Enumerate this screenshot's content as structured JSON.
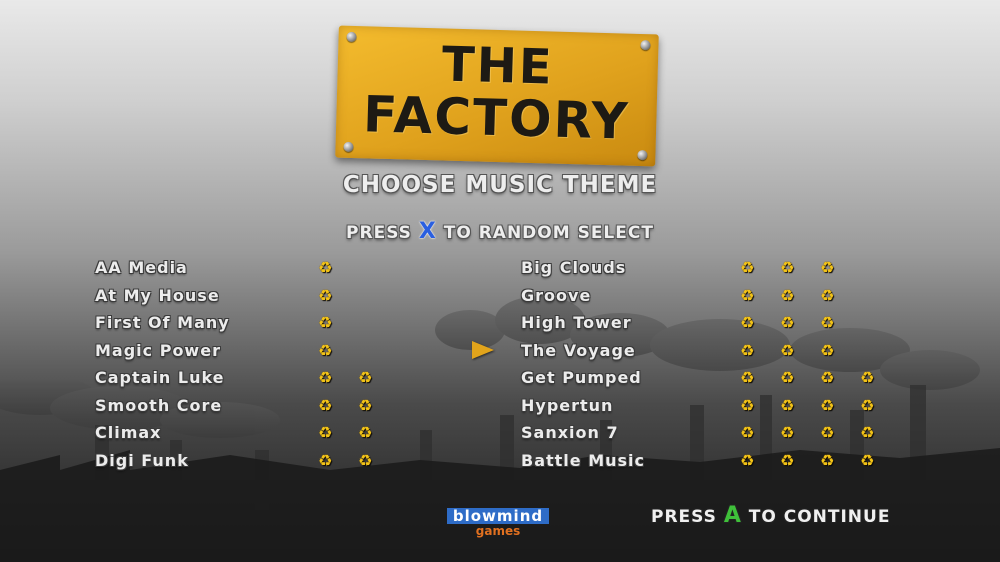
{
  "sign": {
    "line1": "THE",
    "line2": "FACTORY"
  },
  "heading": "CHOOSE MUSIC THEME",
  "random_prompt": {
    "before": "PRESS",
    "key": "X",
    "after": "TO RANDOM SELECT"
  },
  "left_tracks": [
    {
      "name": "AA Media",
      "rating": 1
    },
    {
      "name": "At My House",
      "rating": 1
    },
    {
      "name": "First Of Many",
      "rating": 1
    },
    {
      "name": "Magic Power",
      "rating": 1
    },
    {
      "name": "Captain Luke",
      "rating": 2
    },
    {
      "name": "Smooth Core",
      "rating": 2
    },
    {
      "name": "Climax",
      "rating": 2
    },
    {
      "name": "Digi Funk",
      "rating": 2
    }
  ],
  "right_tracks": [
    {
      "name": "Big Clouds",
      "rating": 3
    },
    {
      "name": "Groove",
      "rating": 3
    },
    {
      "name": "High Tower",
      "rating": 3
    },
    {
      "name": "The Voyage",
      "rating": 3
    },
    {
      "name": "Get Pumped",
      "rating": 4
    },
    {
      "name": "Hypertun",
      "rating": 4
    },
    {
      "name": "Sanxion 7",
      "rating": 4
    },
    {
      "name": "Battle Music",
      "rating": 4
    }
  ],
  "selected_track": "The Voyage",
  "rating_icon": "recycle-icon",
  "logo": {
    "brand": "blowmind",
    "sub": "games"
  },
  "continue_prompt": {
    "before": "PRESS",
    "key": "A",
    "after": "TO CONTINUE"
  },
  "colors": {
    "sign": "#e0a21d",
    "rating": "#f2c318",
    "x_button": "#2a5fe0",
    "a_button": "#3fc03a",
    "cursor": "#e2a41b"
  }
}
